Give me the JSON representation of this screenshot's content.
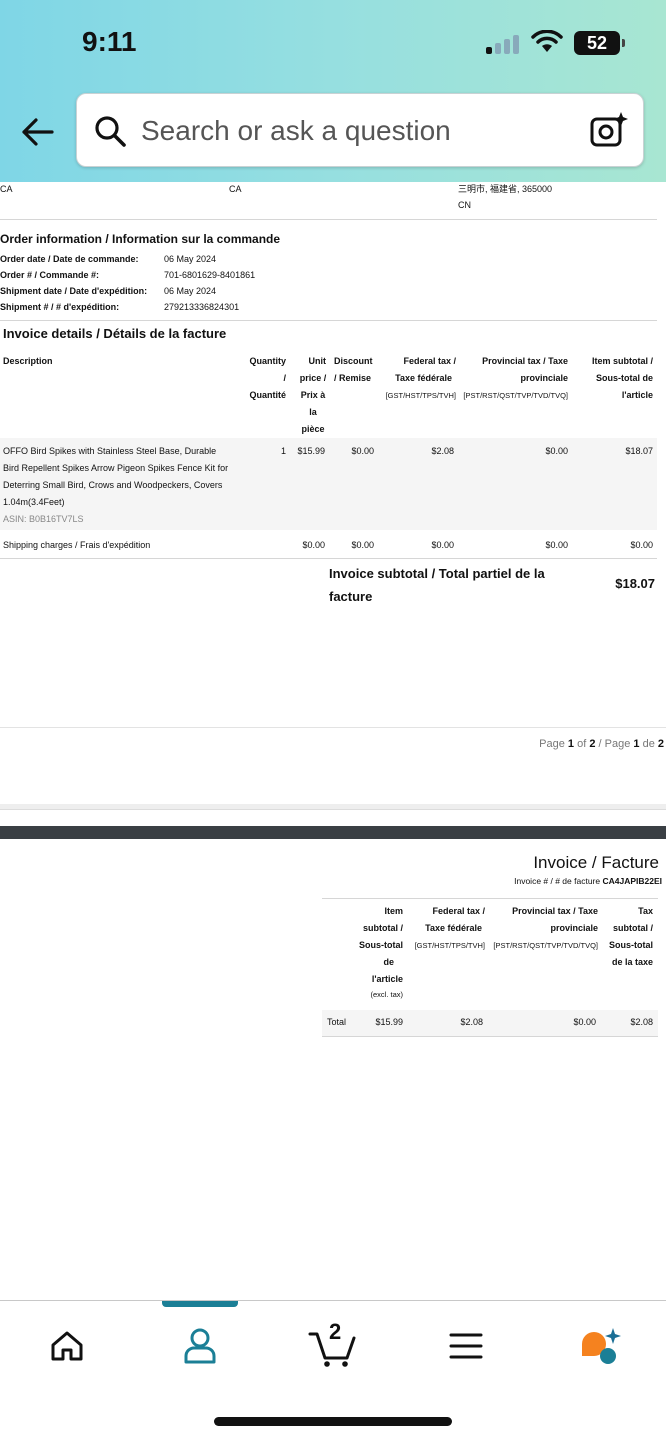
{
  "status_bar": {
    "time": "9:11",
    "battery": "52"
  },
  "search": {
    "placeholder": "Search or ask a question"
  },
  "page1": {
    "addr_left": "CA",
    "addr_mid": "CA",
    "addr_right_line1": "三明市, 福建省, 365000",
    "addr_right_line2": "CN",
    "order_title": "Order information / Information sur la commande",
    "order_rows": [
      {
        "k": "Order date / Date de commande:",
        "v": "06 May 2024"
      },
      {
        "k": "Order # / Commande #:",
        "v": "701-6801629-8401861"
      },
      {
        "k": "Shipment date / Date d'expédition:",
        "v": "06 May 2024"
      },
      {
        "k": "Shipment # / # d'expédition:",
        "v": "279213336824301"
      }
    ],
    "invoice_title": "Invoice details / Détails de la facture",
    "headers": {
      "description": "Description",
      "quantity": [
        "Quantity",
        "/",
        "Quantité"
      ],
      "unit_price": [
        "Unit",
        "price /",
        "Prix à",
        "la",
        "pièce"
      ],
      "discount": [
        "Discount",
        "/ Remise"
      ],
      "federal": [
        "Federal tax /",
        "Taxe fédérale",
        "[GST/HST/TPS/TVH]"
      ],
      "provincial": [
        "Provincial tax / Taxe",
        "provinciale",
        "[PST/RST/QST/TVP/TVD/TVQ]"
      ],
      "item_subtotal": [
        "Item subtotal /",
        "Sous-total de",
        "l'article"
      ]
    },
    "item": {
      "desc_lines": [
        "OFFO Bird Spikes with Stainless Steel Base, Durable",
        "Bird Repellent Spikes Arrow Pigeon Spikes Fence Kit for",
        "Deterring Small Bird, Crows and Woodpeckers, Covers",
        "1.04m(3.4Feet)"
      ],
      "asin": "ASIN: B0B16TV7LS",
      "qty": "1",
      "unit_price": "$15.99",
      "discount": "$0.00",
      "federal": "$2.08",
      "provincial": "$0.00",
      "subtotal": "$18.07"
    },
    "shipping": {
      "label": "Shipping charges / Frais d'expédition",
      "unit_price": "$0.00",
      "discount": "$0.00",
      "federal": "$0.00",
      "provincial": "$0.00",
      "subtotal": "$0.00"
    },
    "invoice_subtotal_label_1": "Invoice subtotal / Total partiel de la",
    "invoice_subtotal_label_2": "facture",
    "invoice_subtotal_value": "$18.07",
    "page_footer": {
      "pre": "Page ",
      "n1": "1",
      "of": " of ",
      "n2": "2",
      "mid": " / Page ",
      "n3": "1",
      "de": " de ",
      "n4": "2"
    }
  },
  "page2": {
    "title": "Invoice / Facture",
    "invoice_no_label": "Invoice # / # de facture ",
    "invoice_no": "CA4JAPIB22EI",
    "headers": {
      "item_subtotal": [
        "Item",
        "subtotal /",
        "Sous-total",
        "de",
        "l'article",
        "(excl. tax)"
      ],
      "federal": [
        "Federal tax /",
        "Taxe fédérale",
        "[GST/HST/TPS/TVH]"
      ],
      "provincial": [
        "Provincial tax / Taxe",
        "provinciale",
        "[PST/RST/QST/TVP/TVD/TVQ]"
      ],
      "tax_subtotal": [
        "Tax",
        "subtotal /",
        "Sous-total",
        "de la taxe"
      ]
    },
    "total_row": {
      "label": "Total",
      "item_subtotal": "$15.99",
      "federal": "$2.08",
      "provincial": "$0.00",
      "tax_subtotal": "$2.08"
    }
  },
  "bottom_nav": {
    "items": [
      "home-icon",
      "account-icon",
      "cart-icon",
      "menu-icon",
      "rufus-icon"
    ],
    "cart_count": "2",
    "colors": {
      "accent": "#1b7f96",
      "rufus_orange": "#f5821f",
      "rufus_teal": "#1b7f96"
    }
  }
}
